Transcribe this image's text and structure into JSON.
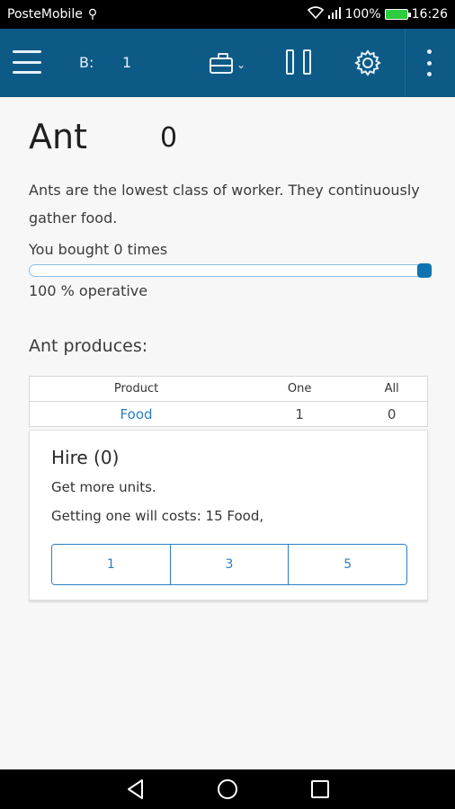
{
  "status_bar": {
    "carrier": "PosteMobile",
    "battery_percent": "100%",
    "time": "16:26"
  },
  "app_bar": {
    "b_label": "B:",
    "b_value": "1"
  },
  "unit": {
    "name": "Ant",
    "count": "0",
    "description": "Ants are the lowest class of worker. They continuously gather food.",
    "bought_text": "You bought 0 times",
    "operative_text": "100 % operative",
    "operative_level": 1.0
  },
  "produces": {
    "title": "Ant produces:",
    "headers": [
      "Product",
      "One",
      "All"
    ],
    "rows": [
      {
        "product": "Food",
        "one": "1",
        "all": "0"
      }
    ]
  },
  "hire": {
    "title": "Hire (0)",
    "subtitle": "Get more units.",
    "cost_text": "Getting one will costs: 15 Food,",
    "options": [
      "1",
      "3",
      "5"
    ]
  },
  "colors": {
    "app_bar": "#0e5a86",
    "accent": "#2a7fc0",
    "slider_thumb": "#0e74b1"
  }
}
